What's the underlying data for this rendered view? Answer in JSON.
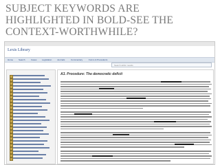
{
  "slide": {
    "heading": "SUBJECT KEYWORDS ARE HIGHLIGHTED IN BOLD-SEE THE CONTEXT-WORTHWHILE?"
  },
  "app": {
    "brand": "Lexis Library",
    "nav_items": [
      "Home",
      "Search",
      "Cases",
      "Legislation",
      "Journals",
      "Commentary",
      "Forms & Precedents"
    ],
    "document_title": "A3. Procedure: The democratic deficit",
    "search_placeholder": "Search within results"
  },
  "colors": {
    "heading": "#7a7a7a",
    "link": "#2b4d8a",
    "navbar": "#dfe6ef",
    "folder_icon": "#c8a64a"
  }
}
